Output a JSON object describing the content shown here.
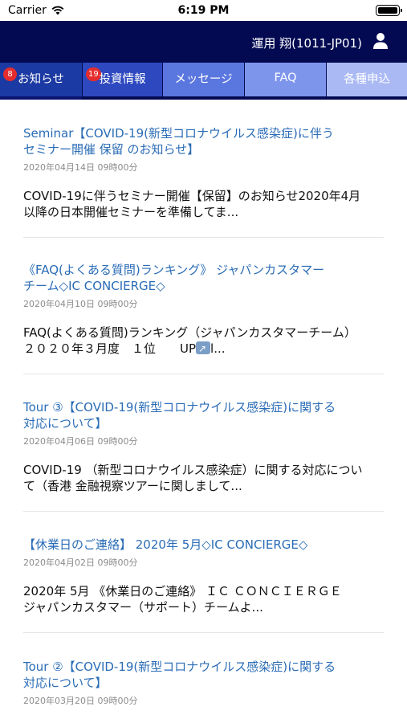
{
  "status_bar": {
    "carrier": "Carrier",
    "time": "6:19 PM"
  },
  "header": {
    "user_name": "運用 翔(1011-JP01)",
    "user_icon": "user-icon",
    "background": "#030a52"
  },
  "tabs": [
    {
      "label": "お知らせ",
      "badge": "8",
      "selected": true
    },
    {
      "label": "投資情報",
      "badge": "19",
      "selected": false
    },
    {
      "label": "メッセージ",
      "badge": "",
      "selected": false
    },
    {
      "label": "FAQ",
      "badge": "",
      "selected": false
    },
    {
      "label": "各種申込",
      "badge": "",
      "selected": false
    }
  ],
  "news": [
    {
      "title": "Seminar【COVID-19(新型コロナウイルス感染症)に伴うセミナー開催 保留 のお知らせ】",
      "title_line1": "Seminar【COVID-19(新型コロナウイルス感染症)に伴う",
      "title_line2": "セミナー開催 保留 のお知らせ】",
      "date": "2020年04月14日 09時00分",
      "body_line1": "COVID-19に伴うセミナー開催【保留】のお知らせ2020年4月",
      "body_line2": "以降の日本開催セミナーを準備してま..."
    },
    {
      "title_line1": "《FAQ(よくある質問)ランキング》 ジャパンカスタマー",
      "title_line2": "チーム◇IC CONCIERGE◇",
      "date": "2020年04月10日 09時00分",
      "body_line1": "FAQ(よくある質問)ランキング（ジャパンカスタマーチーム）",
      "body_line2_a": "２０２０年３月度　１位　　UP",
      "body_line2_b": "l..."
    },
    {
      "title_line1": "Tour ③【COVID-19(新型コロナウイルス感染症)に関する",
      "title_line2": "対応について】",
      "date": "2020年04月06日 09時00分",
      "body_line1": "COVID-19 （新型コロナウイルス感染症）に関する対応につい",
      "body_line2": "て（香港 金融視察ツアーに関しまして..."
    },
    {
      "title_line1": "【休業日のご連絡】 2020年 5月◇IC CONCIERGE◇",
      "date": "2020年04月02日 09時00分",
      "body_line1": "2020年 5月 《休業日のご連絡》 ＩＣ ＣＯＮＣＩＥＲＧＥ",
      "body_line2": "ジャパンカスタマー（サポート）チームよ..."
    },
    {
      "title_line1": "Tour ②【COVID-19(新型コロナウイルス感染症)に関する",
      "title_line2": "対応について】",
      "date": "2020年03月20日 09時00分"
    }
  ]
}
